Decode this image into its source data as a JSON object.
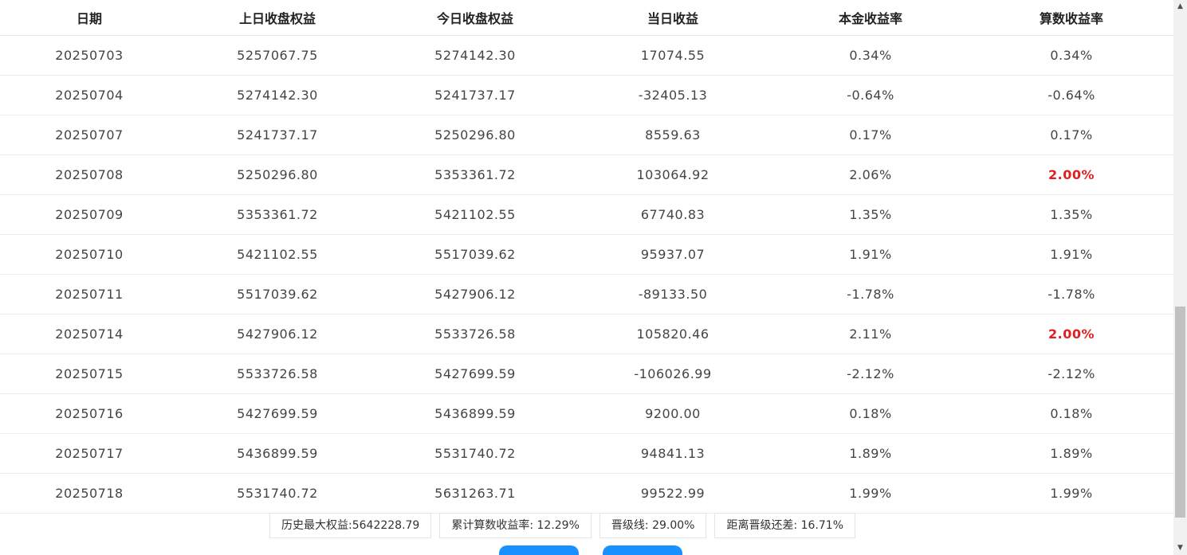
{
  "table": {
    "headers": [
      "日期",
      "上日收盘权益",
      "今日收盘权益",
      "当日收益",
      "本金收益率",
      "算数收益率"
    ],
    "rows": [
      {
        "date": "20250703",
        "prev": "5257067.75",
        "today": "5274142.30",
        "pnl": "17074.55",
        "principal_rate": "0.34%",
        "arith_rate": "0.34%",
        "capped": false
      },
      {
        "date": "20250704",
        "prev": "5274142.30",
        "today": "5241737.17",
        "pnl": "-32405.13",
        "principal_rate": "-0.64%",
        "arith_rate": "-0.64%",
        "capped": false
      },
      {
        "date": "20250707",
        "prev": "5241737.17",
        "today": "5250296.80",
        "pnl": "8559.63",
        "principal_rate": "0.17%",
        "arith_rate": "0.17%",
        "capped": false
      },
      {
        "date": "20250708",
        "prev": "5250296.80",
        "today": "5353361.72",
        "pnl": "103064.92",
        "principal_rate": "2.06%",
        "arith_rate": "2.00%",
        "capped": true
      },
      {
        "date": "20250709",
        "prev": "5353361.72",
        "today": "5421102.55",
        "pnl": "67740.83",
        "principal_rate": "1.35%",
        "arith_rate": "1.35%",
        "capped": false
      },
      {
        "date": "20250710",
        "prev": "5421102.55",
        "today": "5517039.62",
        "pnl": "95937.07",
        "principal_rate": "1.91%",
        "arith_rate": "1.91%",
        "capped": false
      },
      {
        "date": "20250711",
        "prev": "5517039.62",
        "today": "5427906.12",
        "pnl": "-89133.50",
        "principal_rate": "-1.78%",
        "arith_rate": "-1.78%",
        "capped": false
      },
      {
        "date": "20250714",
        "prev": "5427906.12",
        "today": "5533726.58",
        "pnl": "105820.46",
        "principal_rate": "2.11%",
        "arith_rate": "2.00%",
        "capped": true
      },
      {
        "date": "20250715",
        "prev": "5533726.58",
        "today": "5427699.59",
        "pnl": "-106026.99",
        "principal_rate": "-2.12%",
        "arith_rate": "-2.12%",
        "capped": false
      },
      {
        "date": "20250716",
        "prev": "5427699.59",
        "today": "5436899.59",
        "pnl": "9200.00",
        "principal_rate": "0.18%",
        "arith_rate": "0.18%",
        "capped": false
      },
      {
        "date": "20250717",
        "prev": "5436899.59",
        "today": "5531740.72",
        "pnl": "94841.13",
        "principal_rate": "1.89%",
        "arith_rate": "1.89%",
        "capped": false
      },
      {
        "date": "20250718",
        "prev": "5531740.72",
        "today": "5631263.71",
        "pnl": "99522.99",
        "principal_rate": "1.99%",
        "arith_rate": "1.99%",
        "capped": false
      }
    ]
  },
  "summary": {
    "max_equity": "历史最大权益:5642228.79",
    "cumulative_rate": "累计算数收益率: 12.29%",
    "promotion_line": "晋级线: 29.00%",
    "gap_to_promotion": "距离晋级还差: 16.71%"
  },
  "colors": {
    "highlight": "#e02020",
    "button": "#1890ff"
  },
  "scrollbar": {
    "up_icon": "▲",
    "down_icon": "▼"
  }
}
